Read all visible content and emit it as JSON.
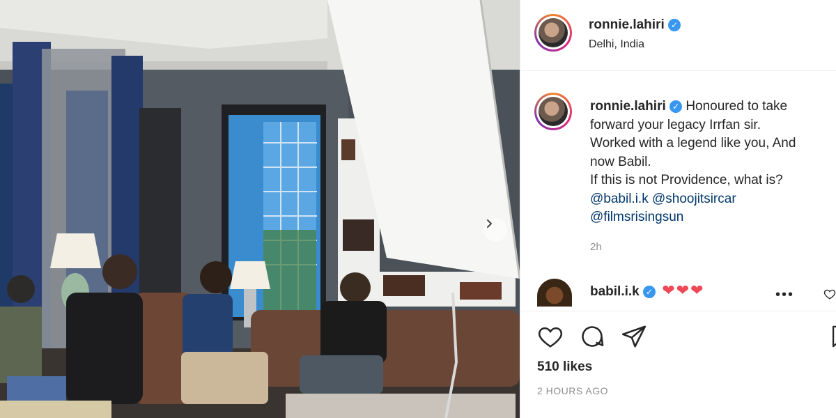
{
  "post": {
    "author": "ronnie.lahiri",
    "location": "Delhi, India",
    "caption": {
      "username": "ronnie.lahiri",
      "text_line1": "Honoured to take",
      "text_line2": "forward your legacy Irrfan sir.",
      "text_line3": "Worked with a legend like you, And",
      "text_line4": "now Babil.",
      "text_line5": "If this is not Providence, what is?",
      "mention1": "@babil.i.k",
      "mention2": "@shoojitsircar",
      "mention3": "@filmsrisingsun",
      "time": "2h"
    },
    "comment": {
      "username": "babil.i.k",
      "text": "❤❤❤"
    },
    "likes": "510 likes",
    "posted": "2 HOURS AGO"
  },
  "icons": {
    "verified": "verified-badge-icon",
    "next": "chevron-right-icon",
    "like": "heart-icon",
    "comment": "comment-icon",
    "share": "paper-plane-icon",
    "save": "bookmark-icon",
    "more": "more-options-icon"
  },
  "colors": {
    "verified": "#3897f0",
    "heart": "#ed4956",
    "mention": "#00376b",
    "muted": "#8e8e8e"
  }
}
